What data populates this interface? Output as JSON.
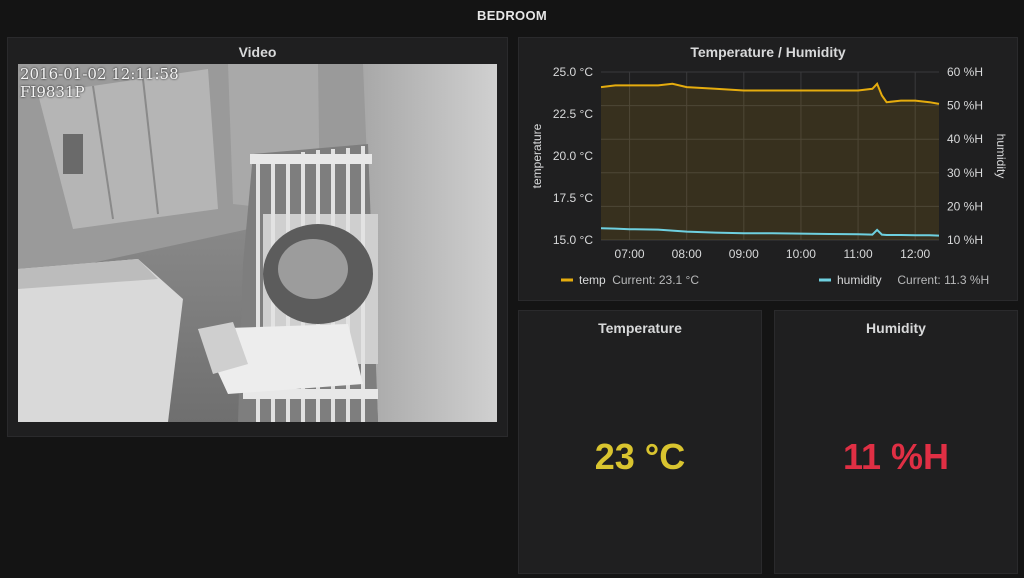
{
  "dashboard": {
    "title": "BEDROOM"
  },
  "video": {
    "title": "Video",
    "timestamp": "2016-01-02 12:11:58",
    "camera_id": "FI9831P"
  },
  "chart_panel": {
    "title": "Temperature / Humidity"
  },
  "chart_data": {
    "type": "line",
    "title": "Temperature / Humidity",
    "x_ticks": [
      "07:00",
      "08:00",
      "09:00",
      "10:00",
      "11:00",
      "12:00"
    ],
    "x_range": [
      "06:30",
      "12:25"
    ],
    "y_left": {
      "label": "temperature",
      "unit": "°C",
      "range": [
        15.0,
        25.0
      ],
      "ticks": [
        "25.0 °C",
        "22.5 °C",
        "20.0 °C",
        "17.5 °C",
        "15.0 °C"
      ]
    },
    "y_right": {
      "label": "humidity",
      "unit": "%H",
      "range": [
        10,
        60
      ],
      "ticks": [
        "60 %H",
        "50 %H",
        "40 %H",
        "30 %H",
        "20 %H",
        "10 %H"
      ]
    },
    "grid": true,
    "legend_placement": "bottom",
    "series": [
      {
        "name": "temp",
        "axis": "left",
        "color": "#e5ac0e",
        "current_label": "Current: 23.1 °C",
        "x": [
          "06:30",
          "06:45",
          "07:00",
          "07:30",
          "07:45",
          "08:00",
          "08:30",
          "09:00",
          "09:30",
          "10:00",
          "10:30",
          "11:00",
          "11:15",
          "11:20",
          "11:25",
          "11:30",
          "11:45",
          "12:00",
          "12:15",
          "12:25"
        ],
        "y": [
          24.1,
          24.2,
          24.2,
          24.2,
          24.3,
          24.1,
          24.0,
          23.9,
          23.9,
          23.9,
          23.9,
          23.9,
          24.0,
          24.3,
          23.6,
          23.2,
          23.3,
          23.3,
          23.2,
          23.1
        ]
      },
      {
        "name": "humidity",
        "axis": "right",
        "color": "#6ed0e0",
        "current_label": "Current: 11.3 %H",
        "x": [
          "06:30",
          "06:45",
          "07:00",
          "07:30",
          "08:00",
          "08:30",
          "09:00",
          "09:30",
          "10:00",
          "10:30",
          "11:00",
          "11:15",
          "11:20",
          "11:25",
          "11:30",
          "11:45",
          "12:00",
          "12:15",
          "12:25"
        ],
        "y": [
          13.5,
          13.4,
          13.2,
          13.1,
          12.5,
          12.2,
          12.0,
          12.0,
          11.9,
          11.8,
          11.7,
          11.6,
          13.0,
          11.6,
          11.5,
          11.5,
          11.4,
          11.4,
          11.3
        ]
      }
    ]
  },
  "temperature_stat": {
    "title": "Temperature",
    "value": "23 °C",
    "color": "#d9c42f"
  },
  "humidity_stat": {
    "title": "Humidity",
    "value": "11 %H",
    "color": "#e02f44"
  }
}
